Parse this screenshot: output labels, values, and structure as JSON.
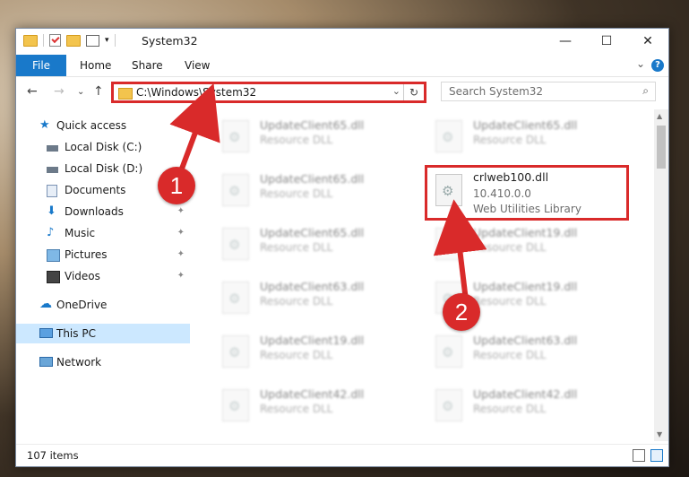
{
  "window": {
    "title": "System32",
    "buttons": {
      "minimize": "—",
      "maximize": "☐",
      "close": "✕"
    }
  },
  "ribbon": {
    "tabs": [
      "File",
      "Home",
      "Share",
      "View"
    ],
    "help": "?"
  },
  "navigation": {
    "back": "←",
    "forward": "→",
    "recent": "⌄",
    "up": "↑",
    "address": "C:\\Windows\\System32",
    "refresh": "↻",
    "search_placeholder": "Search System32",
    "search_icon": "⌕"
  },
  "sidebar": {
    "items": [
      {
        "label": "Quick access",
        "icon": "star-icon"
      },
      {
        "label": "Local Disk (C:)",
        "icon": "drive-icon"
      },
      {
        "label": "Local Disk (D:)",
        "icon": "drive-icon"
      },
      {
        "label": "Documents",
        "icon": "documents-icon",
        "pin": "📌"
      },
      {
        "label": "Downloads",
        "icon": "download-icon",
        "pin": "📌"
      },
      {
        "label": "Music",
        "icon": "music-icon",
        "pin": "📌"
      },
      {
        "label": "Pictures",
        "icon": "pictures-icon",
        "pin": "📌"
      },
      {
        "label": "Videos",
        "icon": "videos-icon",
        "pin": "📌"
      },
      {
        "label": "OneDrive",
        "icon": "cloud-icon"
      },
      {
        "label": "This PC",
        "icon": "computer-icon"
      },
      {
        "label": "Network",
        "icon": "network-icon"
      }
    ]
  },
  "files": {
    "left": [
      {
        "name": "UpdateClient65.dll",
        "desc": "Resource DLL"
      },
      {
        "name": "UpdateClient65.dll",
        "desc": "Resource DLL"
      },
      {
        "name": "UpdateClient65.dll",
        "desc": "Resource DLL"
      },
      {
        "name": "UpdateClient63.dll",
        "desc": "Resource DLL"
      },
      {
        "name": "UpdateClient19.dll",
        "desc": "Resource DLL"
      },
      {
        "name": "UpdateClient42.dll",
        "desc": "Resource DLL"
      }
    ],
    "right": [
      {
        "name": "UpdateClient65.dll",
        "desc": "Resource DLL"
      },
      {
        "name": "crlweb100.dll",
        "version": "10.410.0.0",
        "desc": "Web Utilities Library"
      },
      {
        "name": "UpdateClient19.dll",
        "desc": "Resource DLL"
      },
      {
        "name": "UpdateClient19.dll",
        "desc": "Resource DLL"
      },
      {
        "name": "UpdateClient63.dll",
        "desc": "Resource DLL"
      },
      {
        "name": "UpdateClient42.dll",
        "desc": "Resource DLL"
      }
    ]
  },
  "status": {
    "count": "107 items"
  },
  "callouts": [
    "1",
    "2"
  ],
  "colors": {
    "accent": "#1979ca",
    "highlight": "#d92a2a",
    "selected": "#cce8ff"
  }
}
